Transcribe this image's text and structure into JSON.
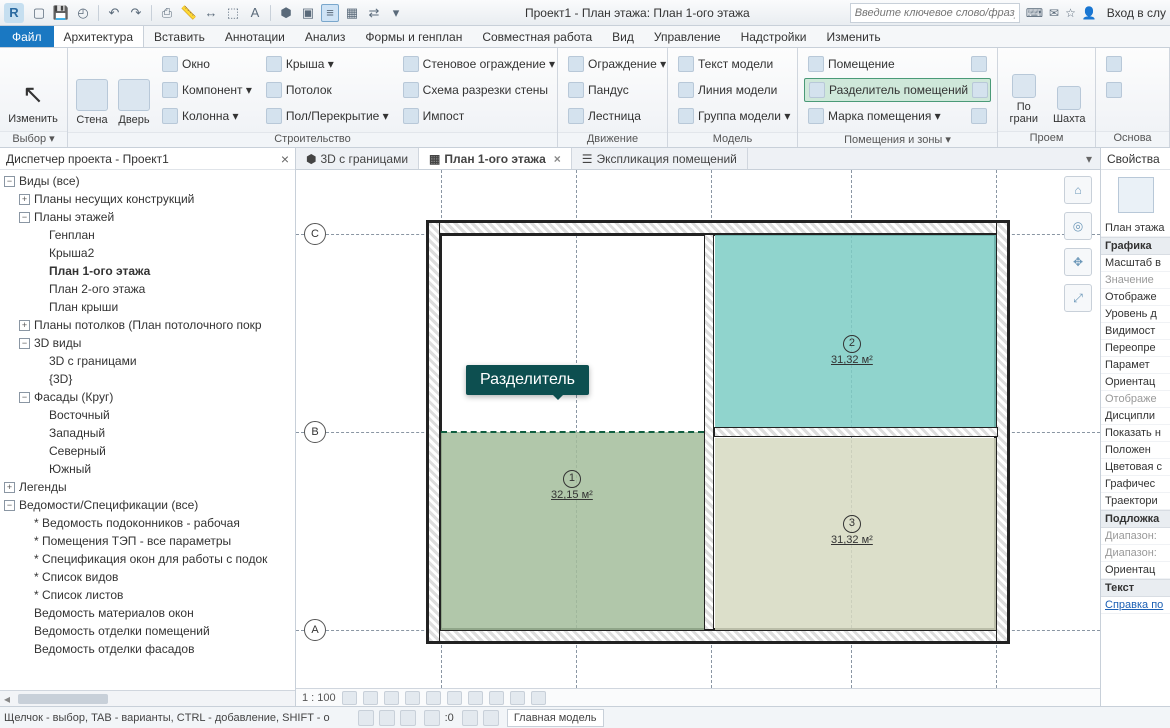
{
  "qat": {
    "title": "Проект1 - План этажа: План 1-ого этажа",
    "search_placeholder": "Введите ключевое слово/фразу",
    "signin": "Вход в слу"
  },
  "menu": {
    "file": "Файл",
    "tabs": [
      "Архитектура",
      "Вставить",
      "Аннотации",
      "Анализ",
      "Формы и генплан",
      "Совместная работа",
      "Вид",
      "Управление",
      "Надстройки",
      "Изменить"
    ]
  },
  "ribbon": {
    "panels": {
      "select": {
        "label": "Выбор ▾",
        "modify": "Изменить"
      },
      "build": {
        "label": "Строительство",
        "wall": "Стена",
        "door": "Дверь",
        "items": [
          "Окно",
          "Компонент ▾",
          "Колонна ▾",
          "Крыша ▾",
          "Потолок",
          "Пол/Перекрытие ▾",
          "Стеновое ограждение ▾",
          "Схема разрезки стены",
          "Импост"
        ]
      },
      "circ": {
        "label": "Движение",
        "items": [
          "Ограждение ▾",
          "Пандус",
          "Лестница"
        ]
      },
      "model": {
        "label": "Модель",
        "items": [
          "Текст модели",
          "Линия  модели",
          "Группа модели ▾"
        ]
      },
      "rooms": {
        "label": "Помещения и зоны ▾",
        "items": [
          "Помещение",
          "Разделитель помещений",
          "Марка помещения ▾"
        ]
      },
      "open": {
        "label": "Проем",
        "byface": "По грани",
        "shaft": "Шахта"
      },
      "base": {
        "label": "Основа"
      }
    }
  },
  "browser": {
    "title": "Диспетчер проекта - Проект1",
    "nodes": [
      {
        "d": 0,
        "t": "−",
        "x": "Виды (все)"
      },
      {
        "d": 1,
        "t": "+",
        "x": "Планы несущих конструкций"
      },
      {
        "d": 1,
        "t": "−",
        "x": "Планы этажей"
      },
      {
        "d": 2,
        "x": "Генплан"
      },
      {
        "d": 2,
        "x": "Крыша2"
      },
      {
        "d": 2,
        "x": "План 1-ого этажа",
        "b": true
      },
      {
        "d": 2,
        "x": "План 2-ого этажа"
      },
      {
        "d": 2,
        "x": "План крыши"
      },
      {
        "d": 1,
        "t": "+",
        "x": "Планы потолков (План потолочного покр"
      },
      {
        "d": 1,
        "t": "−",
        "x": "3D виды"
      },
      {
        "d": 2,
        "x": "3D с границами"
      },
      {
        "d": 2,
        "x": "{3D}"
      },
      {
        "d": 1,
        "t": "−",
        "x": "Фасады (Круг)"
      },
      {
        "d": 2,
        "x": "Восточный"
      },
      {
        "d": 2,
        "x": "Западный"
      },
      {
        "d": 2,
        "x": "Северный"
      },
      {
        "d": 2,
        "x": "Южный"
      },
      {
        "d": 0,
        "t": "+",
        "x": "Легенды"
      },
      {
        "d": 0,
        "t": "−",
        "x": "Ведомости/Спецификации (все)"
      },
      {
        "d": 1,
        "x": "* Ведомость подоконников - рабочая"
      },
      {
        "d": 1,
        "x": "* Помещения ТЭП - все параметры"
      },
      {
        "d": 1,
        "x": "* Спецификация окон для работы с подок"
      },
      {
        "d": 1,
        "x": "* Список видов"
      },
      {
        "d": 1,
        "x": "* Список листов"
      },
      {
        "d": 1,
        "x": "Ведомость материалов окон"
      },
      {
        "d": 1,
        "x": "Ведомость отделки помещений"
      },
      {
        "d": 1,
        "x": "Ведомость отделки фасадов"
      }
    ]
  },
  "doctabs": {
    "t1": "3D с границами",
    "t2": "План 1-ого этажа",
    "t3": "Экспликация помещений"
  },
  "plan": {
    "tooltip": "Разделитель",
    "rooms": {
      "r1": {
        "num": "1",
        "area": "32,15 м²"
      },
      "r2": {
        "num": "2",
        "area": "31,32 м²"
      },
      "r3": {
        "num": "3",
        "area": "31,32 м²"
      }
    },
    "grids": {
      "a": "A",
      "b": "B",
      "c": "C"
    }
  },
  "viewbar": {
    "scale": "1 : 100"
  },
  "props": {
    "title": "Свойства",
    "cat": "План этажа",
    "sections": {
      "g": "Графика",
      "u": "Подложка",
      "t": "Текст"
    },
    "items": [
      "Масштаб в",
      "Значение  ",
      "Отображе",
      "Уровень д",
      "Видимост",
      "Переопре",
      "Парамет",
      "Ориентац",
      "Отображе",
      "Дисципли",
      "Показать н",
      "Положен",
      "Цветовая с",
      "Графичес",
      "Траектори"
    ],
    "underlay": [
      "Диапазон:",
      "Диапазон:",
      "Ориентац"
    ],
    "help": "Справка по"
  },
  "status": {
    "hint": "Щелчок - выбор, TAB - варианты, CTRL - добавление, SHIFT - о",
    "zero": ":0",
    "model": "Главная модель"
  }
}
